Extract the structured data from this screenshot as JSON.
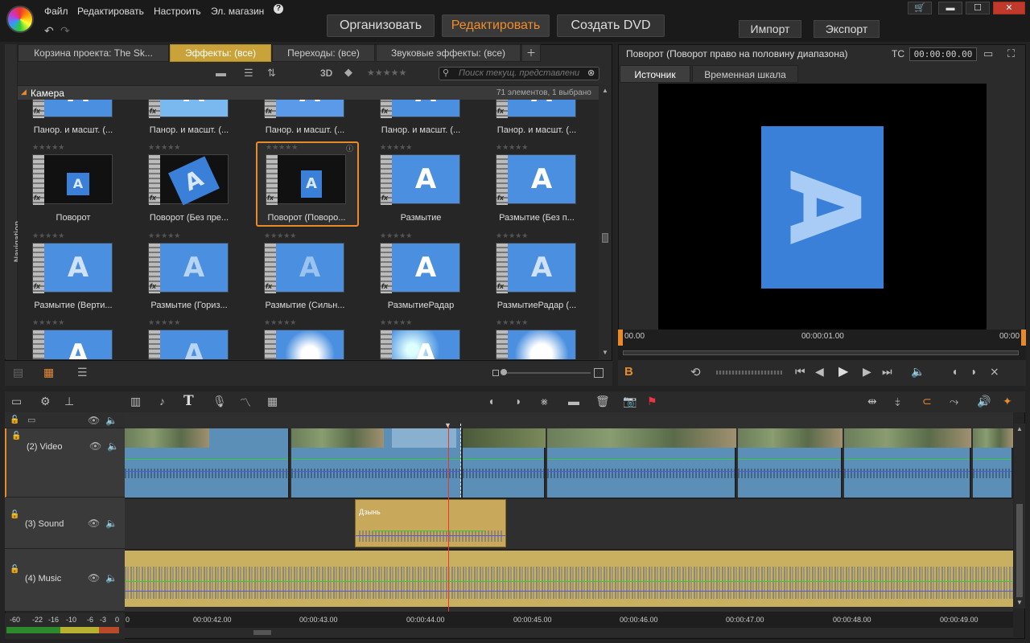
{
  "menu": {
    "file": "Файл",
    "edit": "Редактировать",
    "settings": "Настроить",
    "store": "Эл. магазин",
    "help": "?"
  },
  "modes": {
    "organize": "Организовать",
    "edit": "Редактировать",
    "dvd": "Создать DVD"
  },
  "actions": {
    "import": "Импорт",
    "export": "Экспорт"
  },
  "window_buttons": {
    "cart": "🛒",
    "minimize": "▬",
    "maximize": "☐",
    "close": "✕"
  },
  "library": {
    "tabs": [
      "Корзина проекта: The Sk...",
      "Эффекты: (все)",
      "Переходы: (все)",
      "Звуковые эффекты: (все)"
    ],
    "nav_label": "Navigation",
    "search_placeholder": "Поиск текущ. представлени",
    "label_3d": "3D",
    "category": "Камера",
    "count": "71 элементов, 1 выбрано",
    "items": [
      {
        "caption": "Панор. и масшт. (..."
      },
      {
        "caption": "Панор. и масшт. (..."
      },
      {
        "caption": "Панор. и масшт. (..."
      },
      {
        "caption": "Панор. и масшт. (..."
      },
      {
        "caption": "Панор. и масшт. (..."
      },
      {
        "caption": "Поворот"
      },
      {
        "caption": "Поворот (Без пре..."
      },
      {
        "caption": "Поворот (Поворо..."
      },
      {
        "caption": "Размытие"
      },
      {
        "caption": "Размытие (Без п..."
      },
      {
        "caption": "Размытие (Верти..."
      },
      {
        "caption": "Размытие (Гориз..."
      },
      {
        "caption": "Размытие (Сильн..."
      },
      {
        "caption": "РазмытиеРадар"
      },
      {
        "caption": "РазмытиеРадар (..."
      }
    ],
    "thumb_letter": "A",
    "fx_label": "fx",
    "stars": "★★★★★"
  },
  "player": {
    "title": "Поворот (Поворот право на половину диапазона)",
    "tc_label": "TC",
    "tc_value": "00:00:00.00",
    "tabs": [
      "Источник",
      "Временная шкала"
    ],
    "ruler_start": "00.00",
    "ruler_mid": "00:00:01.00",
    "ruler_end": "00:00",
    "screen_letter": "A",
    "b_label": "B"
  },
  "timeline": {
    "tracks": [
      {
        "name": "(2) Video"
      },
      {
        "name": "(3) Sound"
      },
      {
        "name": "(4) Music"
      }
    ],
    "sound_clip": "Дзынь",
    "ruler": [
      "0",
      "00:00:42.00",
      "00:00:43.00",
      "00:00:44.00",
      "00:00:45.00",
      "00:00:46.00",
      "00:00:47.00",
      "00:00:48.00",
      "00:00:49.00"
    ],
    "meter": [
      "-60",
      "-22",
      "-16",
      "-10",
      "-6",
      "-3",
      "0"
    ]
  },
  "colors": {
    "accent": "#f28c28",
    "selected_tab": "#c9a23a",
    "clip_blue": "#5c8fb8",
    "clip_gold": "#c8b060"
  }
}
